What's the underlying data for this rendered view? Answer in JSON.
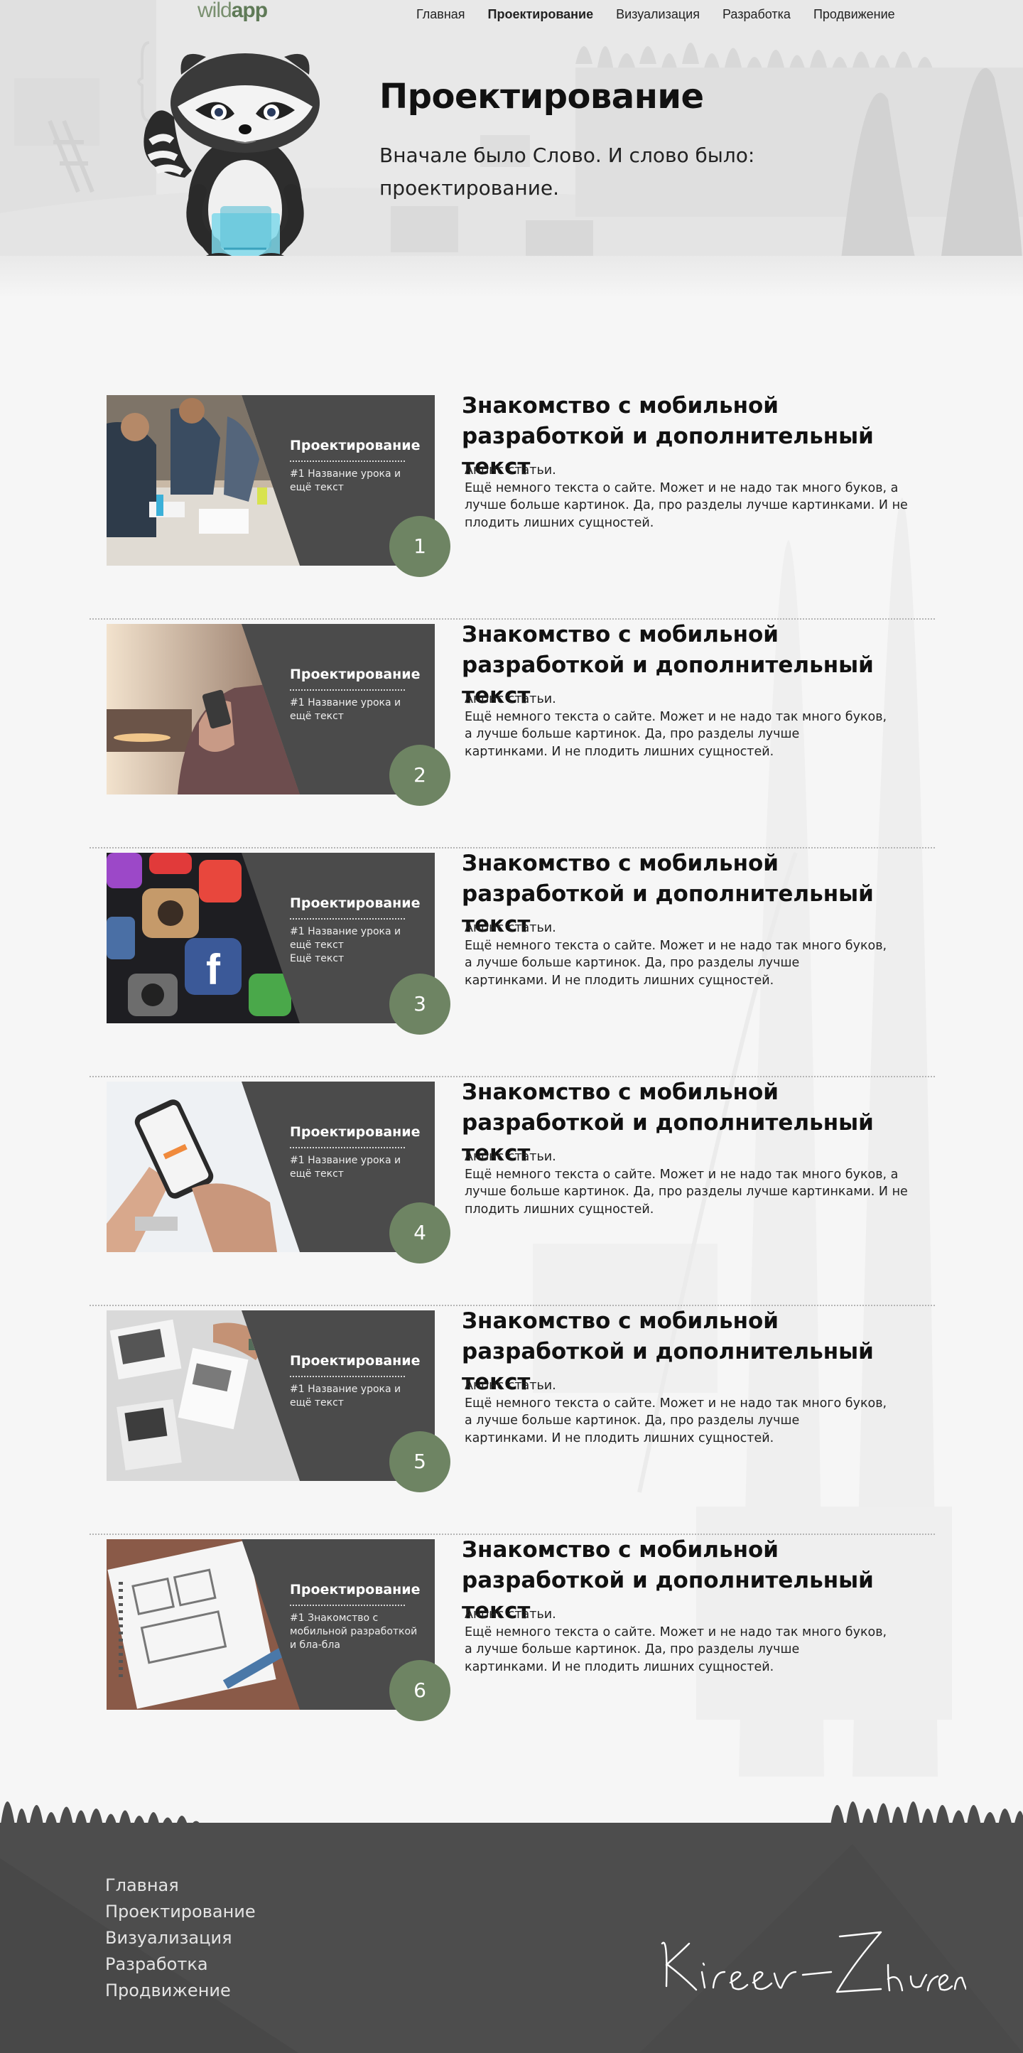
{
  "brand": {
    "logo_text_1": "wild",
    "logo_text_2": "app"
  },
  "nav": {
    "items": [
      {
        "label": "Главная",
        "active": false
      },
      {
        "label": "Проектирование",
        "active": true
      },
      {
        "label": "Визуализация",
        "active": false
      },
      {
        "label": "Разработка",
        "active": false
      },
      {
        "label": "Продвижение",
        "active": false
      }
    ]
  },
  "hero": {
    "title": "Проектирование",
    "subtitle": "Вначале было Слово. И слово было: проектирование."
  },
  "lessons": [
    {
      "number": "1",
      "tag": "Проектирование",
      "desc": "#1 Название урока и ещё текст",
      "title": "Знакомство с мобильной разработкой и дополнительный текст",
      "text": "Анонс статьи.\nЕщё немного текста о сайте. Может и не надо так много буков, а лучше больше картинок. Да, про разделы лучше картинками. И не плодить лишних сущностей.",
      "photo": "team-meeting-photo"
    },
    {
      "number": "2",
      "tag": "Проектирование",
      "desc": "#1 Название урока и ещё текст",
      "title": "Знакомство с мобильной разработкой и дополнительный текст",
      "text": "Анонс статьи.\nЕщё немного текста о сайте. Может и не надо так много буков,\nа лучше больше картинок. Да, про разделы лучше\nкартинками. И не плодить лишних сущностей.",
      "photo": "phone-sunset-photo"
    },
    {
      "number": "3",
      "tag": "Проектирование",
      "desc": "#1 Название урока и ещё текст\nЕщё текст",
      "title": "Знакомство с мобильной разработкой и дополнительный текст",
      "text": "Анонс статьи.\nЕщё немного текста о сайте. Может и не надо так много буков,\nа лучше больше картинок. Да, про разделы лучше\nкартинками. И не плодить лишних сущностей.",
      "photo": "app-icons-photo"
    },
    {
      "number": "4",
      "tag": "Проектирование",
      "desc": "#1 Название урока и ещё текст",
      "title": "Знакомство с мобильной разработкой и дополнительный текст",
      "text": "Анонс статьи.\nЕщё немного текста о сайте. Может и не надо так много буков, а лучше больше картинок. Да, про разделы лучше картинками. И не плодить лишних сущностей.",
      "photo": "hands-phone-photo"
    },
    {
      "number": "5",
      "tag": "Проектирование",
      "desc": "#1 Название урока и ещё текст",
      "title": "Знакомство с мобильной разработкой и дополнительный текст",
      "text": "Анонс статьи.\nЕщё немного текста о сайте. Может и не надо так много буков,\nа лучше больше картинок. Да, про разделы лучше\nкартинками. И не плодить лишних сущностей.",
      "photo": "desk-papers-photo"
    },
    {
      "number": "6",
      "tag": "Проектирование",
      "desc": "#1 Знакомство с мобильной разработкой и бла-бла",
      "title": "Знакомство с мобильной разработкой и дополнительный текст",
      "text": "Анонс статьи.\nЕщё немного текста о сайте. Может и не надо так много буков,\nа лучше больше картинок. Да, про разделы лучше\nкартинками. И не плодить лишних сущностей.",
      "photo": "wireframe-sketch-photo"
    }
  ],
  "footer": {
    "links": [
      "Главная",
      "Проектирование",
      "Визуализация",
      "Разработка",
      "Продвижение"
    ],
    "signature": "Kireev-Zhurenko"
  },
  "colors": {
    "accent": "#6e8463",
    "card": "#4b4b4b",
    "footer": "#4d4d4d",
    "background": "#f6f6f6"
  }
}
